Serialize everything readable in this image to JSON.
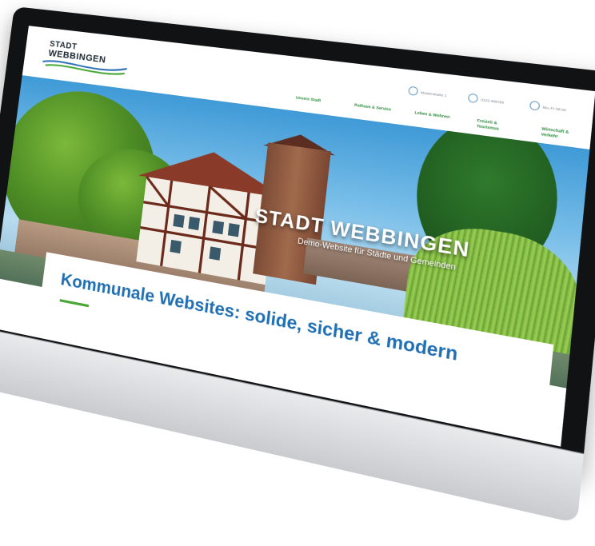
{
  "site": {
    "logo_text_small": "STADT",
    "logo_text_big": "WEBBINGEN",
    "contact": [
      {
        "icon": "location-icon",
        "text": "Musterstraße 1"
      },
      {
        "icon": "phone-icon",
        "text": "0123 456789"
      },
      {
        "icon": "clock-icon",
        "text": "Mo–Fr 08:00"
      }
    ],
    "nav": [
      "Unsere Stadt",
      "Rathaus & Service",
      "Leben & Wohnen",
      "Freizeit & Tourismus",
      "Wirtschaft & Verkehr"
    ]
  },
  "hero": {
    "title": "STADT WEBBINGEN",
    "subtitle": "Demo-Website für Städte und Gemeinden"
  },
  "main": {
    "headline": "Kommunale Websites: solide, sicher & modern"
  },
  "colors": {
    "accent_blue": "#1f6fb2",
    "accent_green": "#4aa838"
  }
}
